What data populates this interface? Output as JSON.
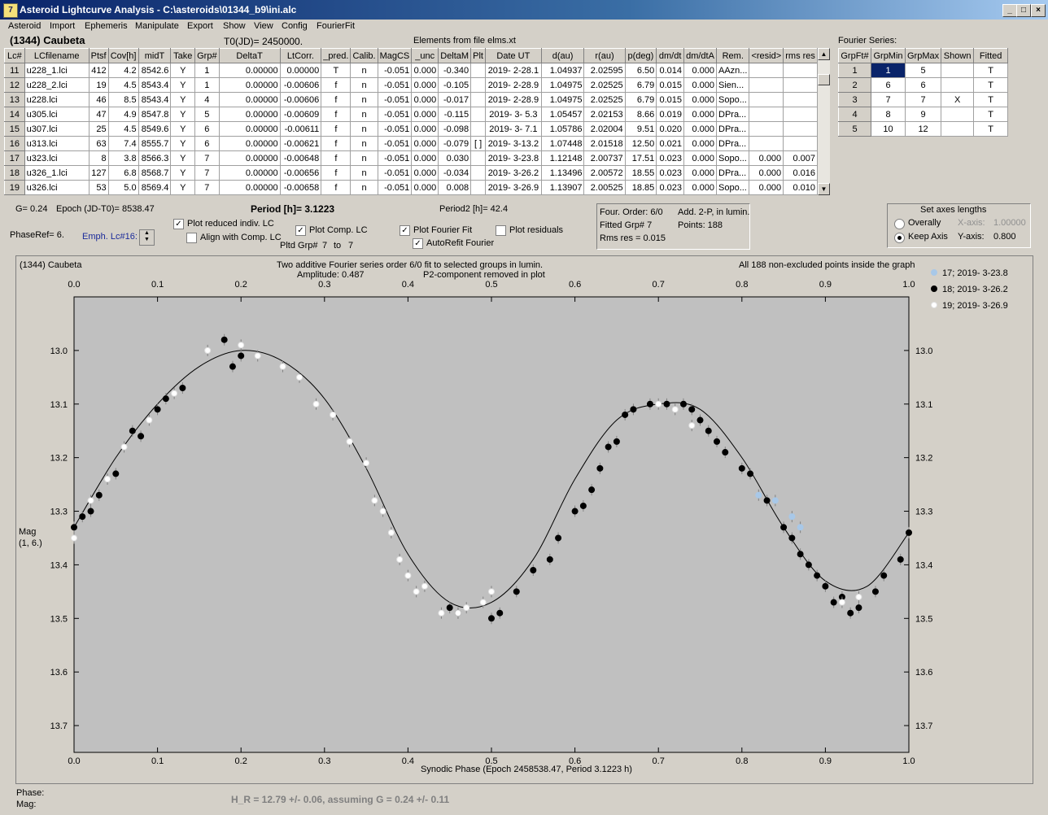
{
  "window": {
    "title": "Asteroid Lightcurve Analysis - C:\\asteroids\\01344_b9\\ini.alc"
  },
  "menu": [
    "Asteroid",
    "Import",
    "Ephemeris",
    "Manipulate",
    "Export",
    "Show",
    "View",
    "Config",
    "FourierFit"
  ],
  "header": {
    "object": "(1344) Caubeta",
    "t0": "T0(JD)= 2450000.",
    "elements": "Elements from file elms.xt"
  },
  "lc_table": {
    "columns": [
      "Lc#",
      "LCfilename",
      "Ptsf",
      "Cov[h]",
      "midT",
      "Take",
      "Grp#",
      "DeltaT",
      "LtCorr.",
      "_pred.",
      "Calib.",
      "MagCS",
      "_unc",
      "DeltaM",
      "Plt",
      "Date UT",
      "d(au)",
      "r(au)",
      "p(deg)",
      "dm/dt",
      "dm/dtA",
      "Rem.",
      "<resid>",
      "rms res"
    ],
    "rows": [
      [
        "11",
        "u228_1.lci",
        "412",
        "4.2",
        "8542.6",
        "Y",
        "1",
        "0.00000",
        "0.00000",
        "T",
        "n",
        "-0.051",
        "0.000",
        "-0.340",
        "",
        "2019- 2-28.1",
        "1.04937",
        "2.02595",
        "6.50",
        "0.014",
        "0.000",
        "AAzn...",
        "",
        ""
      ],
      [
        "12",
        "u228_2.lci",
        "19",
        "4.5",
        "8543.4",
        "Y",
        "1",
        "0.00000",
        "-0.00606",
        "f",
        "n",
        "-0.051",
        "0.000",
        "-0.105",
        "",
        "2019- 2-28.9",
        "1.04975",
        "2.02525",
        "6.79",
        "0.015",
        "0.000",
        "Sien...",
        "",
        ""
      ],
      [
        "13",
        "u228.lci",
        "46",
        "8.5",
        "8543.4",
        "Y",
        "4",
        "0.00000",
        "-0.00606",
        "f",
        "n",
        "-0.051",
        "0.000",
        "-0.017",
        "",
        "2019- 2-28.9",
        "1.04975",
        "2.02525",
        "6.79",
        "0.015",
        "0.000",
        "Sopo...",
        "",
        ""
      ],
      [
        "14",
        "u305.lci",
        "47",
        "4.9",
        "8547.8",
        "Y",
        "5",
        "0.00000",
        "-0.00609",
        "f",
        "n",
        "-0.051",
        "0.000",
        "-0.115",
        "",
        "2019- 3- 5.3",
        "1.05457",
        "2.02153",
        "8.66",
        "0.019",
        "0.000",
        "DPra...",
        "",
        ""
      ],
      [
        "15",
        "u307.lci",
        "25",
        "4.5",
        "8549.6",
        "Y",
        "6",
        "0.00000",
        "-0.00611",
        "f",
        "n",
        "-0.051",
        "0.000",
        "-0.098",
        "",
        "2019- 3- 7.1",
        "1.05786",
        "2.02004",
        "9.51",
        "0.020",
        "0.000",
        "DPra...",
        "",
        ""
      ],
      [
        "16",
        "u313.lci",
        "63",
        "7.4",
        "8555.7",
        "Y",
        "6",
        "0.00000",
        "-0.00621",
        "f",
        "n",
        "-0.051",
        "0.000",
        "-0.079",
        "[ ]",
        "2019- 3-13.2",
        "1.07448",
        "2.01518",
        "12.50",
        "0.021",
        "0.000",
        "DPra...",
        "",
        ""
      ],
      [
        "17",
        "u323.lci",
        "8",
        "3.8",
        "8566.3",
        "Y",
        "7",
        "0.00000",
        "-0.00648",
        "f",
        "n",
        "-0.051",
        "0.000",
        "0.030",
        "",
        "2019- 3-23.8",
        "1.12148",
        "2.00737",
        "17.51",
        "0.023",
        "0.000",
        "Sopo...",
        "0.000",
        "0.007"
      ],
      [
        "18",
        "u326_1.lci",
        "127",
        "6.8",
        "8568.7",
        "Y",
        "7",
        "0.00000",
        "-0.00656",
        "f",
        "n",
        "-0.051",
        "0.000",
        "-0.034",
        "",
        "2019- 3-26.2",
        "1.13496",
        "2.00572",
        "18.55",
        "0.023",
        "0.000",
        "DPra...",
        "0.000",
        "0.016"
      ],
      [
        "19",
        "u326.lci",
        "53",
        "5.0",
        "8569.4",
        "Y",
        "7",
        "0.00000",
        "-0.00658",
        "f",
        "n",
        "-0.051",
        "0.000",
        "0.008",
        "",
        "2019- 3-26.9",
        "1.13907",
        "2.00525",
        "18.85",
        "0.023",
        "0.000",
        "Sopo...",
        "0.000",
        "0.010"
      ]
    ]
  },
  "fourier_series": {
    "title": "Fourier Series:",
    "columns": [
      "GrpFt#",
      "GrpMin",
      "GrpMax",
      "Shown",
      "Fitted"
    ],
    "rows": [
      [
        "1",
        "1",
        "5",
        "",
        "T"
      ],
      [
        "2",
        "6",
        "6",
        "",
        "T"
      ],
      [
        "3",
        "7",
        "7",
        "X",
        "T"
      ],
      [
        "4",
        "8",
        "9",
        "",
        "T"
      ],
      [
        "5",
        "10",
        "12",
        "",
        "T"
      ]
    ]
  },
  "controls": {
    "g": "G= 0.24",
    "epoch": "Epoch (JD-T0)= 8538.47",
    "period": "Period [h]= 3.1223",
    "period2": "Period2 [h]= 42.4",
    "phaseref": "PhaseRef= 6.",
    "emph": "Emph. Lc#16:",
    "plot_reduced": "Plot reduced indiv. LC",
    "align_comp": "Align with Comp. LC",
    "plot_comp": "Plot Comp. LC",
    "pltd_grp": "Pltd Grp#",
    "pltd_from": "7",
    "pltd_to_label": "to",
    "pltd_to": "7",
    "plot_fourier": "Plot Fourier Fit",
    "autorefit": "AutoRefit Fourier",
    "plot_residuals": "Plot residuals",
    "four_order": "Four. Order:  6/0",
    "add2p": "Add. 2-P, in lumin.",
    "fitted_grp": "Fitted Grp# 7",
    "points": "Points: 188",
    "rms": "Rms res      = 0.015",
    "axes_title": "Set axes lengths",
    "overally": "Overally",
    "keep_axis": "Keep Axis",
    "xaxis_label": "X-axis:",
    "xaxis_val": "1.00000",
    "yaxis_label": "Y-axis:",
    "yaxis_val": "0.800",
    "checks": {
      "plot_reduced": "✓",
      "align_comp": "",
      "plot_comp": "✓",
      "plot_fourier": "✓",
      "autorefit": "✓",
      "plot_residuals": ""
    }
  },
  "plot": {
    "object": "(1344) Caubeta",
    "subtitle1": "Two additive Fourier series order 6/0 fit to selected groups in lumin.",
    "subtitle2": "Amplitude: 0.487",
    "subtitle3": "P2-component removed in plot",
    "note": "All 188 non-excluded points inside the graph",
    "ylabel1": "Mag",
    "ylabel2": "(1, 6.)",
    "xlabel": "Synodic Phase (Epoch 2458538.47, Period 3.1223 h)",
    "legend": [
      "17; 2019- 3-23.8",
      "18; 2019- 3-26.2",
      "19; 2019- 3-26.9"
    ]
  },
  "chart_data": {
    "type": "scatter",
    "title": "(1344) Caubeta",
    "xlabel": "Synodic Phase (Epoch 2458538.47, Period 3.1223 h)",
    "ylabel": "Mag",
    "xlim": [
      0,
      1
    ],
    "ylim": [
      12.9,
      13.75
    ],
    "y_inverted": true,
    "xticks": [
      "0.0",
      "0.1",
      "0.2",
      "0.3",
      "0.4",
      "0.5",
      "0.6",
      "0.7",
      "0.8",
      "0.9",
      "1.0"
    ],
    "yticks": [
      "13.0",
      "13.1",
      "13.2",
      "13.3",
      "13.4",
      "13.5",
      "13.6",
      "13.7"
    ],
    "fit": {
      "x": [
        0,
        0.05,
        0.1,
        0.15,
        0.2,
        0.25,
        0.3,
        0.35,
        0.4,
        0.45,
        0.5,
        0.55,
        0.6,
        0.65,
        0.7,
        0.75,
        0.8,
        0.85,
        0.9,
        0.95,
        1.0
      ],
      "y": [
        13.33,
        13.2,
        13.1,
        13.03,
        13.0,
        13.02,
        13.09,
        13.22,
        13.38,
        13.47,
        13.47,
        13.39,
        13.24,
        13.13,
        13.1,
        13.11,
        13.2,
        13.33,
        13.43,
        13.44,
        13.34
      ]
    },
    "series": [
      {
        "name": "17; 2019- 3-23.8",
        "color": "#a8c8e8",
        "x": [
          0.82,
          0.84,
          0.86,
          0.87
        ],
        "y": [
          13.27,
          13.28,
          13.31,
          13.33
        ]
      },
      {
        "name": "18; 2019- 3-26.2",
        "color": "#000000",
        "x": [
          0.0,
          0.01,
          0.02,
          0.03,
          0.05,
          0.07,
          0.08,
          0.1,
          0.11,
          0.13,
          0.18,
          0.19,
          0.2,
          0.45,
          0.46,
          0.5,
          0.51,
          0.53,
          0.55,
          0.57,
          0.58,
          0.6,
          0.61,
          0.62,
          0.63,
          0.64,
          0.65,
          0.66,
          0.67,
          0.69,
          0.71,
          0.73,
          0.74,
          0.75,
          0.76,
          0.77,
          0.78,
          0.8,
          0.81,
          0.83,
          0.85,
          0.86,
          0.87,
          0.88,
          0.89,
          0.9,
          0.91,
          0.92,
          0.93,
          0.94,
          0.96,
          0.97,
          0.99,
          1.0
        ],
        "y": [
          13.33,
          13.31,
          13.3,
          13.27,
          13.23,
          13.15,
          13.16,
          13.11,
          13.09,
          13.07,
          12.98,
          13.03,
          13.01,
          13.48,
          13.49,
          13.5,
          13.49,
          13.45,
          13.41,
          13.39,
          13.35,
          13.3,
          13.29,
          13.26,
          13.22,
          13.18,
          13.17,
          13.12,
          13.11,
          13.1,
          13.1,
          13.1,
          13.11,
          13.13,
          13.15,
          13.17,
          13.19,
          13.22,
          13.23,
          13.28,
          13.33,
          13.35,
          13.38,
          13.4,
          13.42,
          13.44,
          13.47,
          13.46,
          13.49,
          13.48,
          13.45,
          13.42,
          13.39,
          13.34
        ]
      },
      {
        "name": "19; 2019- 3-26.9",
        "color": "#ffffff",
        "x": [
          0.0,
          0.02,
          0.04,
          0.06,
          0.09,
          0.12,
          0.16,
          0.2,
          0.22,
          0.25,
          0.27,
          0.29,
          0.31,
          0.33,
          0.35,
          0.36,
          0.37,
          0.38,
          0.39,
          0.4,
          0.41,
          0.42,
          0.44,
          0.46,
          0.47,
          0.49,
          0.5,
          0.7,
          0.72,
          0.74,
          0.92,
          0.94
        ],
        "y": [
          13.35,
          13.28,
          13.24,
          13.18,
          13.13,
          13.08,
          13.0,
          12.99,
          13.01,
          13.03,
          13.05,
          13.1,
          13.12,
          13.17,
          13.21,
          13.28,
          13.3,
          13.34,
          13.39,
          13.42,
          13.45,
          13.44,
          13.49,
          13.49,
          13.48,
          13.47,
          13.45,
          13.1,
          13.11,
          13.14,
          13.47,
          13.46
        ]
      }
    ]
  },
  "status": {
    "phase": "Phase:",
    "mag": "Mag:",
    "hr": "H_R = 12.79 +/- 0.06, assuming G = 0.24 +/- 0.11"
  },
  "colors": {
    "titlebar": "#0a246a",
    "plot_bg": "#c0c0c0",
    "selected": "#0a246a"
  }
}
